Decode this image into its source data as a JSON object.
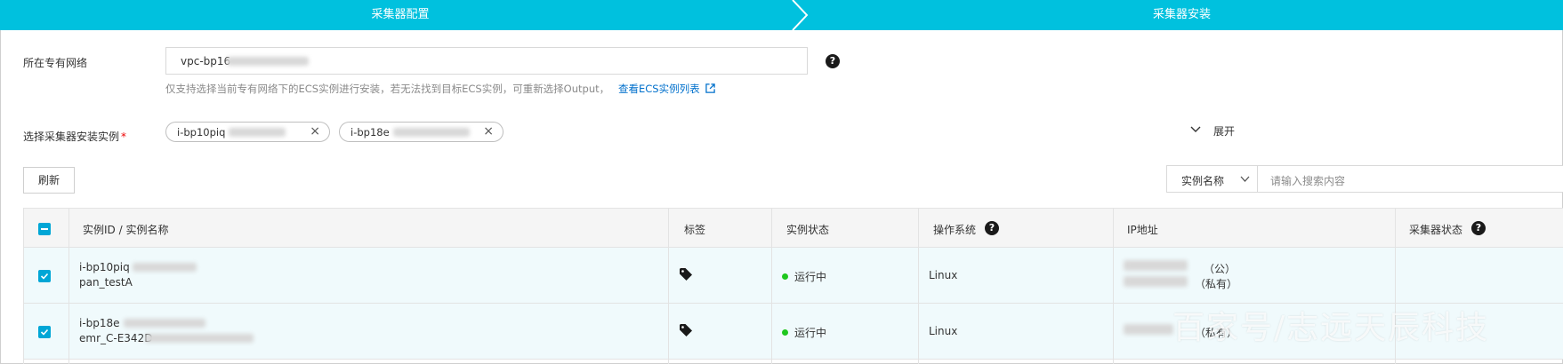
{
  "steps": {
    "step1": "采集器配置",
    "step2": "采集器安装"
  },
  "vpc": {
    "label": "所在专有网络",
    "value": "vpc-bp16",
    "hint": "仅支持选择当前专有网络下的ECS实例进行安装，若无法找到目标ECS实例，可重新选择Output，",
    "link": "查看ECS实例列表"
  },
  "instances": {
    "label": "选择采集器安装实例",
    "required": "*",
    "selected": [
      {
        "text": "i-bp10piq"
      },
      {
        "text": "i-bp18e"
      }
    ],
    "expand_label": "展开"
  },
  "toolbar": {
    "refresh_label": "刷新",
    "search_field": "实例名称",
    "search_placeholder": "请输入搜索内容"
  },
  "table": {
    "headers": {
      "instance": "实例ID / 实例名称",
      "tags": "标签",
      "status": "实例状态",
      "os": "操作系统",
      "ip": "IP地址",
      "collector": "采集器状态"
    },
    "rows": [
      {
        "id": "i-bp10piq",
        "name": "pan_testA",
        "status": "运行中",
        "os": "Linux",
        "ip_public": "（公）",
        "ip_private": "（私有）"
      },
      {
        "id": "i-bp18e",
        "name": "emr_C-E342D",
        "status": "运行中",
        "os": "Linux",
        "ip_private": "（私有）"
      }
    ]
  },
  "watermark": "百家号/志远天辰科技",
  "colors": {
    "accent": "#00c1de",
    "checkbox": "#00a6d6",
    "running": "#1ec71e",
    "link": "#0070cc"
  }
}
